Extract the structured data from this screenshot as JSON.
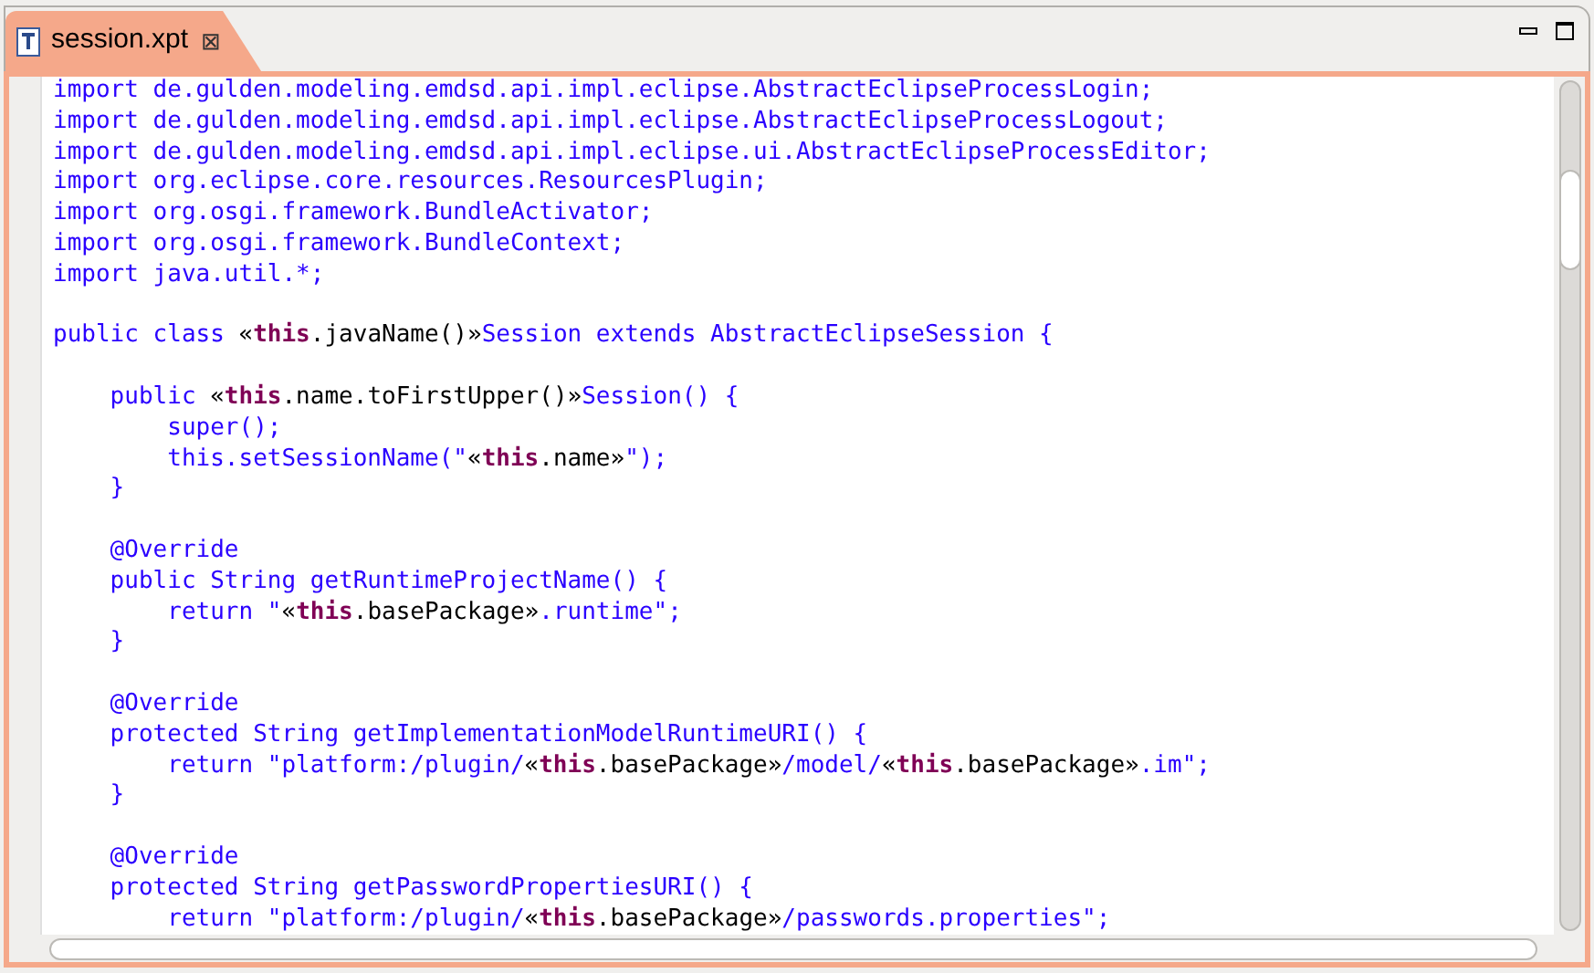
{
  "tab": {
    "title": "session.xpt",
    "close": "⊠",
    "selected": true
  },
  "lines": [
    {
      "kind": "code",
      "segments": [
        {
          "kind": "text",
          "text": "import de.gulden.modeling.emdsd.api.impl.eclipse.AbstractEclipseProcessLogin;"
        }
      ]
    },
    {
      "kind": "code",
      "segments": [
        {
          "kind": "text",
          "text": "import de.gulden.modeling.emdsd.api.impl.eclipse.AbstractEclipseProcessLogout;"
        }
      ]
    },
    {
      "kind": "code",
      "segments": [
        {
          "kind": "text",
          "text": "import de.gulden.modeling.emdsd.api.impl.eclipse.ui.AbstractEclipseProcessEditor;"
        }
      ]
    },
    {
      "kind": "code",
      "segments": [
        {
          "kind": "text",
          "text": "import org.eclipse.core.resources.ResourcesPlugin;"
        }
      ]
    },
    {
      "kind": "code",
      "segments": [
        {
          "kind": "text",
          "text": "import org.osgi.framework.BundleActivator;"
        }
      ]
    },
    {
      "kind": "code",
      "segments": [
        {
          "kind": "text",
          "text": "import org.osgi.framework.BundleContext;"
        }
      ]
    },
    {
      "kind": "code",
      "segments": [
        {
          "kind": "text",
          "text": "import java.util.*;"
        }
      ]
    },
    {
      "kind": "blank"
    },
    {
      "kind": "code",
      "segments": [
        {
          "kind": "text",
          "text": "public class "
        },
        {
          "kind": "expr",
          "text": "«"
        },
        {
          "kind": "keyword",
          "text": "this"
        },
        {
          "kind": "expr",
          "text": ".javaName()»"
        },
        {
          "kind": "text",
          "text": "Session extends AbstractEclipseSession {"
        }
      ]
    },
    {
      "kind": "blank"
    },
    {
      "kind": "code",
      "segments": [
        {
          "kind": "text",
          "text": "    public "
        },
        {
          "kind": "expr",
          "text": "«"
        },
        {
          "kind": "keyword",
          "text": "this"
        },
        {
          "kind": "expr",
          "text": ".name.toFirstUpper()»"
        },
        {
          "kind": "text",
          "text": "Session() {"
        }
      ]
    },
    {
      "kind": "code",
      "segments": [
        {
          "kind": "text",
          "text": "        super();"
        }
      ]
    },
    {
      "kind": "code",
      "segments": [
        {
          "kind": "text",
          "text": "        this.setSessionName(\""
        },
        {
          "kind": "expr",
          "text": "«"
        },
        {
          "kind": "keyword",
          "text": "this"
        },
        {
          "kind": "expr",
          "text": ".name»"
        },
        {
          "kind": "text",
          "text": "\");"
        }
      ]
    },
    {
      "kind": "code",
      "segments": [
        {
          "kind": "text",
          "text": "    }"
        }
      ]
    },
    {
      "kind": "blank"
    },
    {
      "kind": "code",
      "segments": [
        {
          "kind": "text",
          "text": "    @Override"
        }
      ]
    },
    {
      "kind": "code",
      "segments": [
        {
          "kind": "text",
          "text": "    public String getRuntimeProjectName() {"
        }
      ]
    },
    {
      "kind": "code",
      "segments": [
        {
          "kind": "text",
          "text": "        return \""
        },
        {
          "kind": "expr",
          "text": "«"
        },
        {
          "kind": "keyword",
          "text": "this"
        },
        {
          "kind": "expr",
          "text": ".basePackage»"
        },
        {
          "kind": "text",
          "text": ".runtime\";"
        }
      ]
    },
    {
      "kind": "code",
      "segments": [
        {
          "kind": "text",
          "text": "    }"
        }
      ]
    },
    {
      "kind": "blank"
    },
    {
      "kind": "code",
      "segments": [
        {
          "kind": "text",
          "text": "    @Override"
        }
      ]
    },
    {
      "kind": "code",
      "segments": [
        {
          "kind": "text",
          "text": "    protected String getImplementationModelRuntimeURI() {"
        }
      ]
    },
    {
      "kind": "code",
      "segments": [
        {
          "kind": "text",
          "text": "        return \"platform:/plugin/"
        },
        {
          "kind": "expr",
          "text": "«"
        },
        {
          "kind": "keyword",
          "text": "this"
        },
        {
          "kind": "expr",
          "text": ".basePackage»"
        },
        {
          "kind": "text",
          "text": "/model/"
        },
        {
          "kind": "expr",
          "text": "«"
        },
        {
          "kind": "keyword",
          "text": "this"
        },
        {
          "kind": "expr",
          "text": ".basePackage»"
        },
        {
          "kind": "text",
          "text": ".im\";"
        }
      ]
    },
    {
      "kind": "code",
      "segments": [
        {
          "kind": "text",
          "text": "    }"
        }
      ]
    },
    {
      "kind": "blank"
    },
    {
      "kind": "code",
      "segments": [
        {
          "kind": "text",
          "text": "    @Override"
        }
      ]
    },
    {
      "kind": "code",
      "segments": [
        {
          "kind": "text",
          "text": "    protected String getPasswordPropertiesURI() {"
        }
      ]
    },
    {
      "kind": "code",
      "segments": [
        {
          "kind": "text",
          "text": "        return \"platform:/plugin/"
        },
        {
          "kind": "expr",
          "text": "«"
        },
        {
          "kind": "keyword",
          "text": "this"
        },
        {
          "kind": "expr",
          "text": ".basePackage»"
        },
        {
          "kind": "text",
          "text": "/passwords.properties\";"
        }
      ]
    }
  ]
}
